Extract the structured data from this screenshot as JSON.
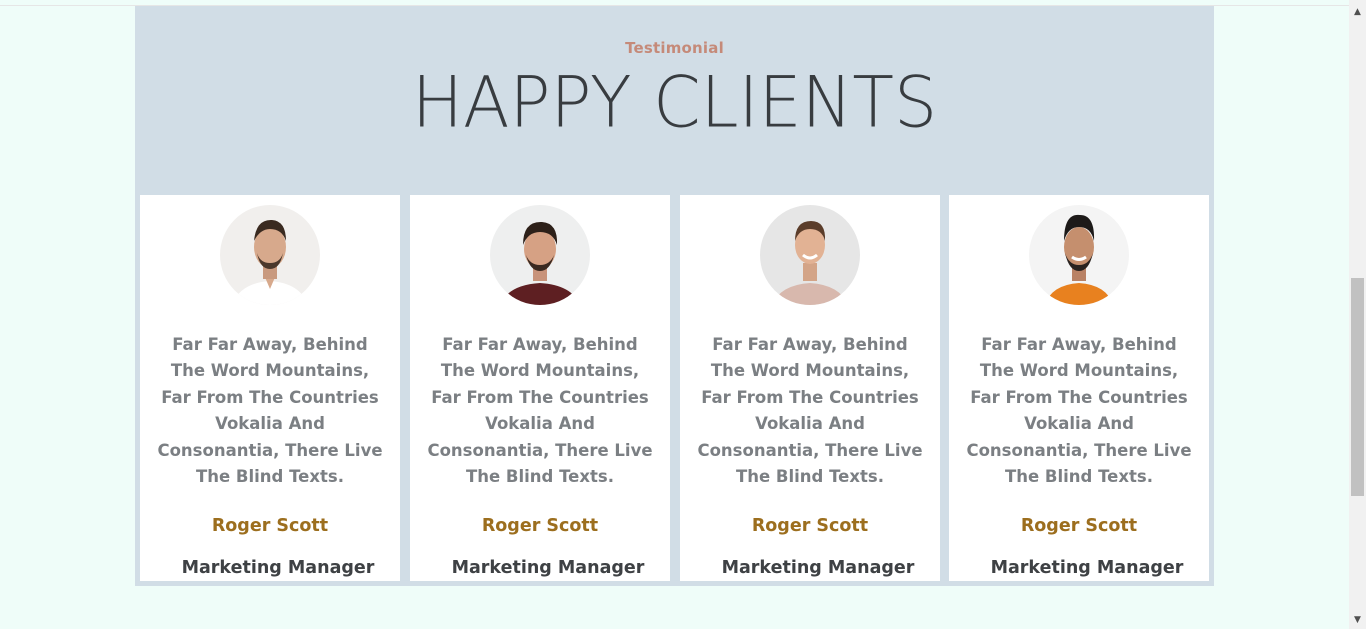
{
  "section": {
    "eyebrow": "Testimonial",
    "heading": "HAPPY CLIENTS"
  },
  "testimonials": [
    {
      "quote": "Far Far Away, Behind The Word Mountains, Far From The Countries Vokalia And Consonantia, There Live The Blind Texts.",
      "name": "Roger Scott",
      "role": "Marketing Manager",
      "avatar_colors": {
        "shirt": "#ffffff",
        "skin": "#d7a98c",
        "hair": "#3a2a20",
        "bg": "#f1efed"
      }
    },
    {
      "quote": "Far Far Away, Behind The Word Mountains, Far From The Countries Vokalia And Consonantia, There Live The Blind Texts.",
      "name": "Roger Scott",
      "role": "Marketing Manager",
      "avatar_colors": {
        "shirt": "#5e1f22",
        "skin": "#d6a184",
        "hair": "#2d2019",
        "bg": "#eeefef"
      }
    },
    {
      "quote": "Far Far Away, Behind The Word Mountains, Far From The Countries Vokalia And Consonantia, There Live The Blind Texts.",
      "name": "Roger Scott",
      "role": "Marketing Manager",
      "avatar_colors": {
        "shirt": "#d8b8ad",
        "skin": "#e2b294",
        "hair": "#5b3d2a",
        "bg": "#e6e6e6"
      }
    },
    {
      "quote": "Far Far Away, Behind The Word Mountains, Far From The Countries Vokalia And Consonantia, There Live The Blind Texts.",
      "name": "Roger Scott",
      "role": "Marketing Manager",
      "avatar_colors": {
        "shirt": "#e8811f",
        "skin": "#c58f6e",
        "hair": "#1d1a19",
        "bg": "#f4f4f4"
      }
    }
  ],
  "colors": {
    "page_bg": "#effdf9",
    "section_bg": "#d1dde6",
    "eyebrow": "#c58a79",
    "heading": "#383c40",
    "quote": "#7b7f83",
    "name": "#9c6e1e",
    "role": "#3e4144"
  },
  "scrollbar": {
    "up_icon": "triangle-up",
    "down_icon": "triangle-down"
  }
}
